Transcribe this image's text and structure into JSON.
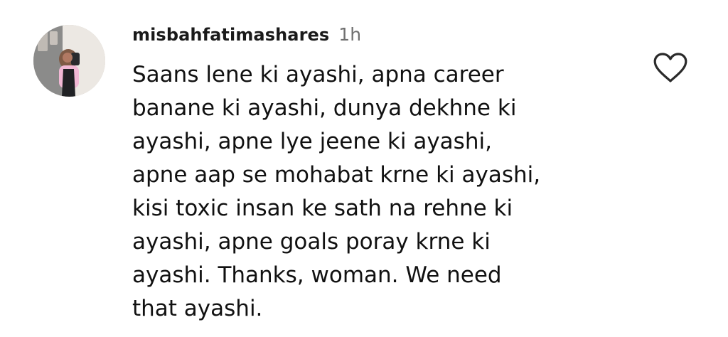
{
  "comment": {
    "username": "misbahfatimashares",
    "time": "1h",
    "lines": [
      "Saans lene ki ayashi, apna career",
      "banane ki ayashi, dunya dekhne ki",
      "ayashi, apne lye jeene ki ayashi,",
      "apne aap se mohabat krne ki ayashi,",
      "kisi toxic insan ke sath na rehne ki",
      "ayashi, apne goals poray krne ki",
      "ayashi. Thanks, woman. We need",
      "that ayashi."
    ],
    "icons": {
      "avatar": "profile-avatar-icon",
      "like": "heart-icon"
    },
    "colors": {
      "text": "#111111",
      "timestamp": "#6f6f6f",
      "heart": "#2a2a2a"
    }
  }
}
